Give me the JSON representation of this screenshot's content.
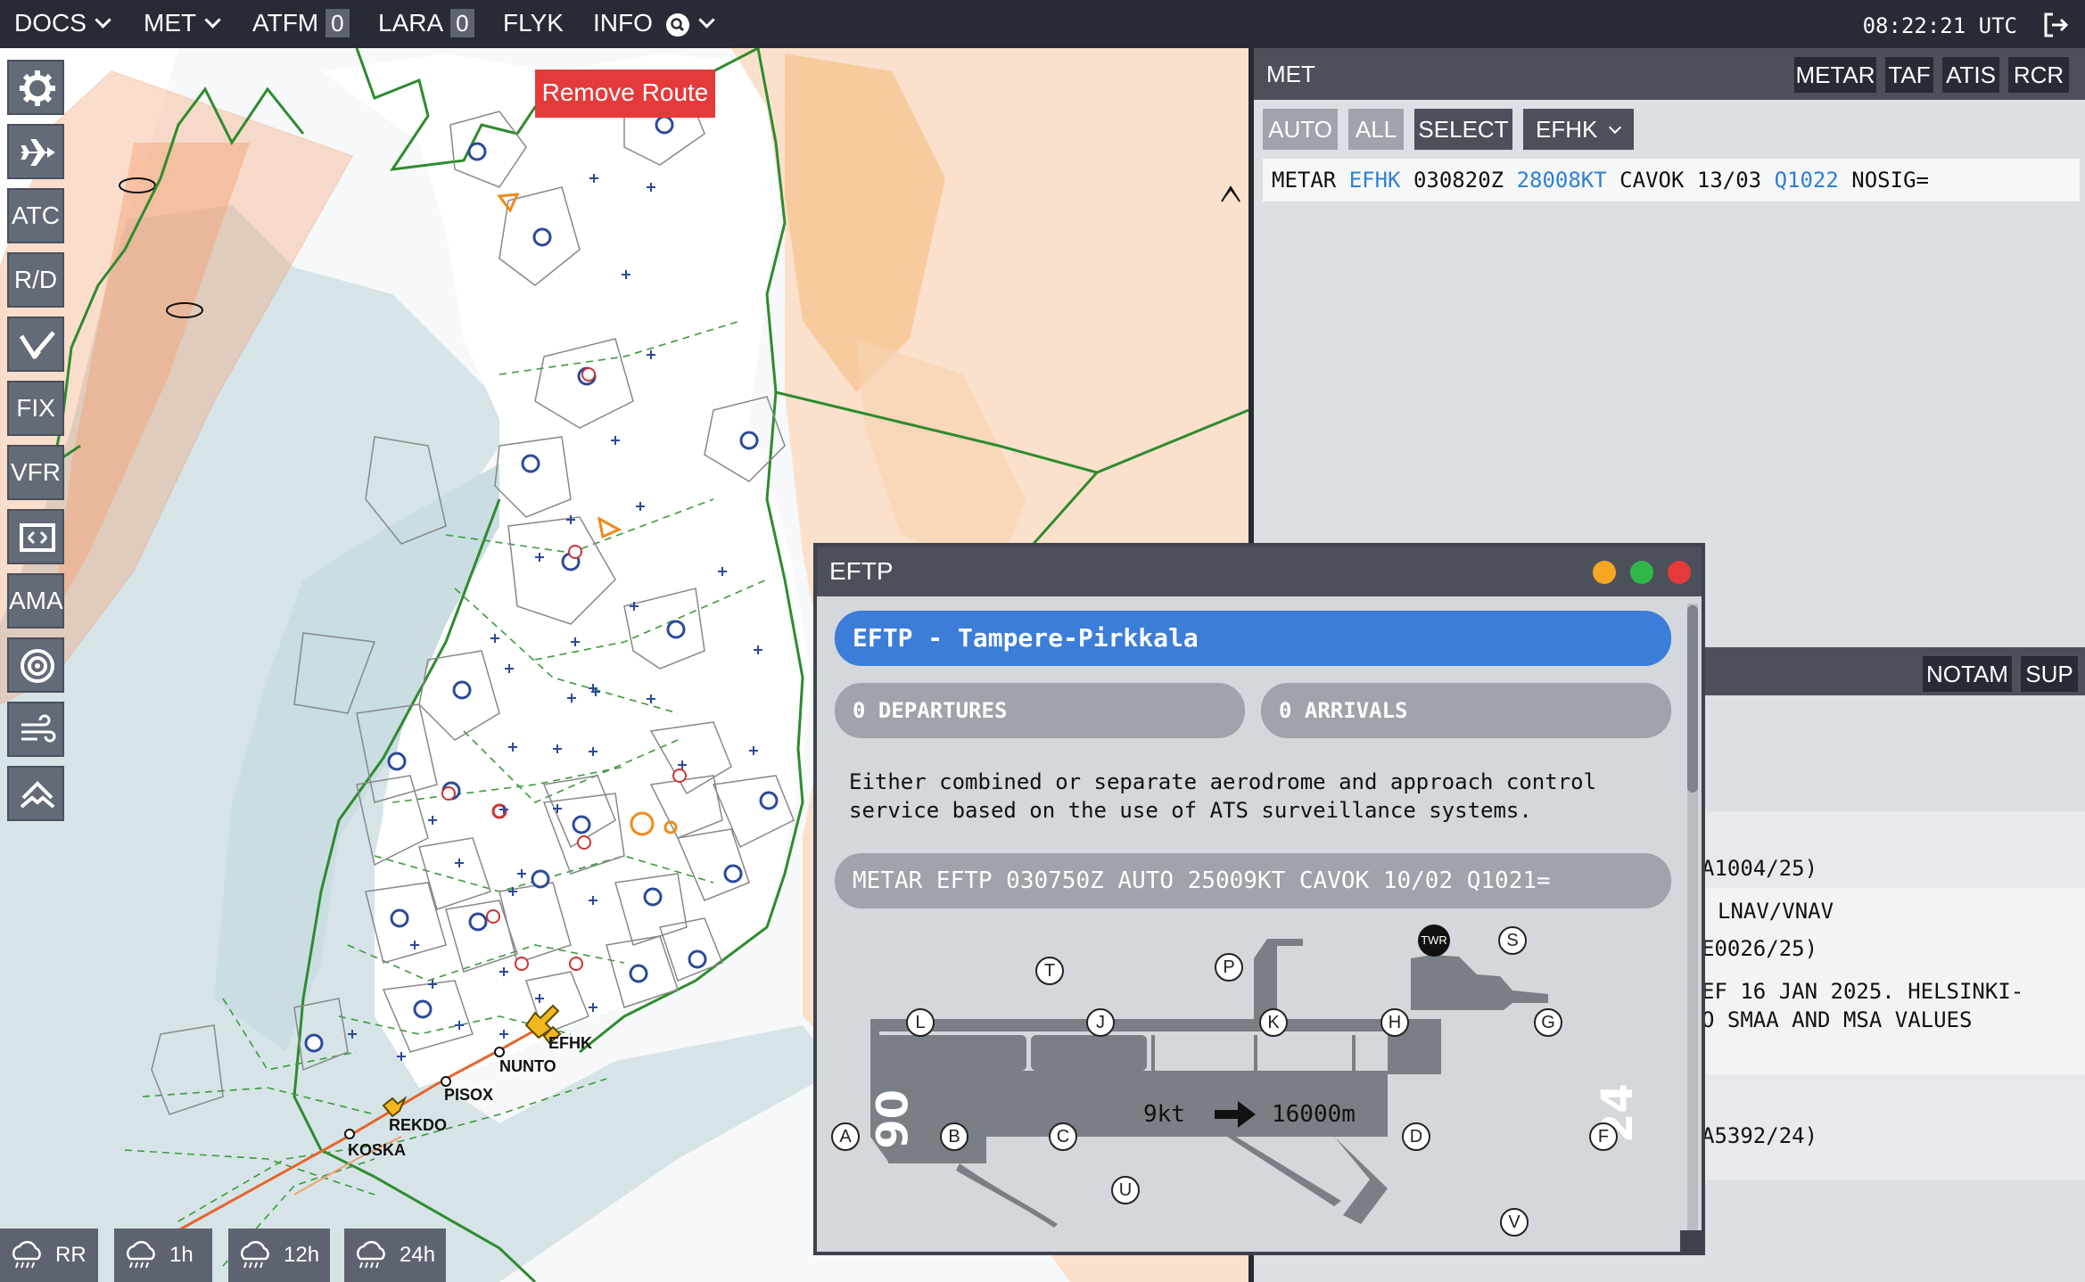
{
  "topbar": {
    "menus": [
      {
        "label": "DOCS",
        "chevron": true
      },
      {
        "label": "MET",
        "chevron": true
      },
      {
        "label": "ATFM",
        "count": "0"
      },
      {
        "label": "LARA",
        "count": "0"
      },
      {
        "label": "FLYK"
      },
      {
        "label": "INFO",
        "chevron": true,
        "icon": "search-badge-icon"
      }
    ],
    "clock": "08:22:21 UTC",
    "logout_icon": "logout-icon"
  },
  "toolbar": {
    "items": [
      {
        "label": "",
        "icon": "gear-icon"
      },
      {
        "label": "",
        "icon": "airplane-icon"
      },
      {
        "label": "ATC"
      },
      {
        "label": "R/D"
      },
      {
        "label": "",
        "icon": "glide-path-icon"
      },
      {
        "label": "FIX"
      },
      {
        "label": "VFR"
      },
      {
        "label": "",
        "icon": "frame-icon"
      },
      {
        "label": "AMA"
      },
      {
        "label": "",
        "icon": "radar-target-icon"
      },
      {
        "label": "",
        "icon": "wind-icon"
      },
      {
        "label": "",
        "icon": "terrain-icon"
      }
    ]
  },
  "map": {
    "remove_route": "Remove Route",
    "waypoints": [
      "EFHK",
      "NUNTO",
      "PISOX",
      "REKDO",
      "KOSKA"
    ],
    "weather_buttons": [
      {
        "label": "RR",
        "icon": "cloud-rain-icon"
      },
      {
        "label": "1h",
        "icon": "cloud-rain-icon"
      },
      {
        "label": "12h",
        "icon": "cloud-rain-icon"
      },
      {
        "label": "24h",
        "icon": "cloud-rain-icon"
      }
    ]
  },
  "met_panel": {
    "title": "MET",
    "tabs": [
      "METAR",
      "TAF",
      "ATIS",
      "RCR"
    ],
    "filters": [
      "AUTO",
      "ALL",
      "SELECT"
    ],
    "station": "EFHK",
    "metar": {
      "prefix": "METAR",
      "station": "EFHK",
      "time": "030820Z",
      "wind": "28008KT",
      "middle": "CAVOK 13/03",
      "qnh": "Q1022",
      "trend": "NOSIG="
    }
  },
  "notam_panel": {
    "tabs": [
      "NOTAM",
      "SUP"
    ],
    "fragments": [
      "A1004/25)",
      "LNAV/VNAV",
      "E0026/25)",
      "EF 16 JAN 2025. HELSINKI-",
      "O SMAA AND MSA VALUES",
      "A5392/24)"
    ]
  },
  "popup": {
    "title": "EFTP",
    "aerodrome": "EFTP - Tampere-Pirkkala",
    "departures": "0 DEPARTURES",
    "arrivals": "0 ARRIVALS",
    "description": "Either combined or separate aerodrome and approach control service based on the use of ATS surveillance systems.",
    "metar": "METAR EFTP 030750Z AUTO 25009KT CAVOK 10/02 Q1021=",
    "runway": {
      "left_end": "06",
      "right_end": "24",
      "wind": "9kt",
      "visibility": "16000m",
      "twr": "TWR",
      "taxiways": [
        "T",
        "P",
        "S",
        "L",
        "J",
        "K",
        "H",
        "G",
        "A",
        "B",
        "C",
        "D",
        "F",
        "U",
        "V"
      ]
    }
  },
  "colors": {
    "topbar": "#262b36",
    "accent_blue": "#3b7dd8",
    "remove_route": "#e53a3a",
    "fir_border": "#2e8b2e",
    "restricted_area": "#f5a070"
  }
}
